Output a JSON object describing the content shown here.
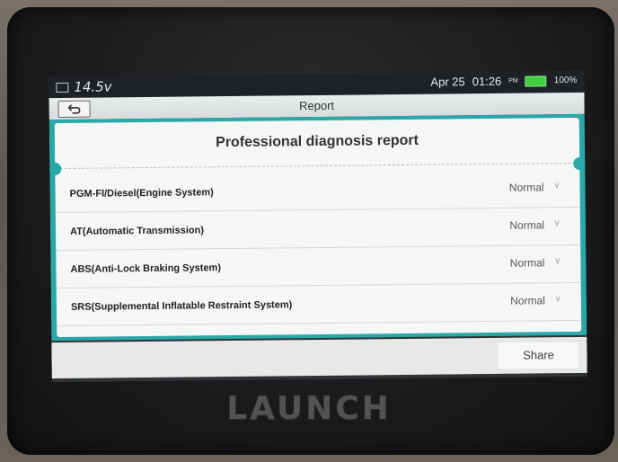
{
  "status": {
    "voltage": "14.5v",
    "date": "Apr 25",
    "time": "01:26",
    "ampm": "PM",
    "battery": "100%"
  },
  "header": {
    "title": "Report"
  },
  "report": {
    "title": "Professional diagnosis report",
    "rows": [
      {
        "system": "PGM-FI/Diesel(Engine System)",
        "status": "Normal"
      },
      {
        "system": "AT(Automatic Transmission)",
        "status": "Normal"
      },
      {
        "system": "ABS(Anti-Lock Braking System)",
        "status": "Normal"
      },
      {
        "system": "SRS(Supplemental Inflatable Restraint System)",
        "status": "Normal"
      }
    ]
  },
  "footer": {
    "share_label": "Share"
  },
  "device": {
    "brand": "LAUNCH"
  },
  "colors": {
    "accent": "#2aa8a8",
    "battery": "#3fcf3f"
  }
}
